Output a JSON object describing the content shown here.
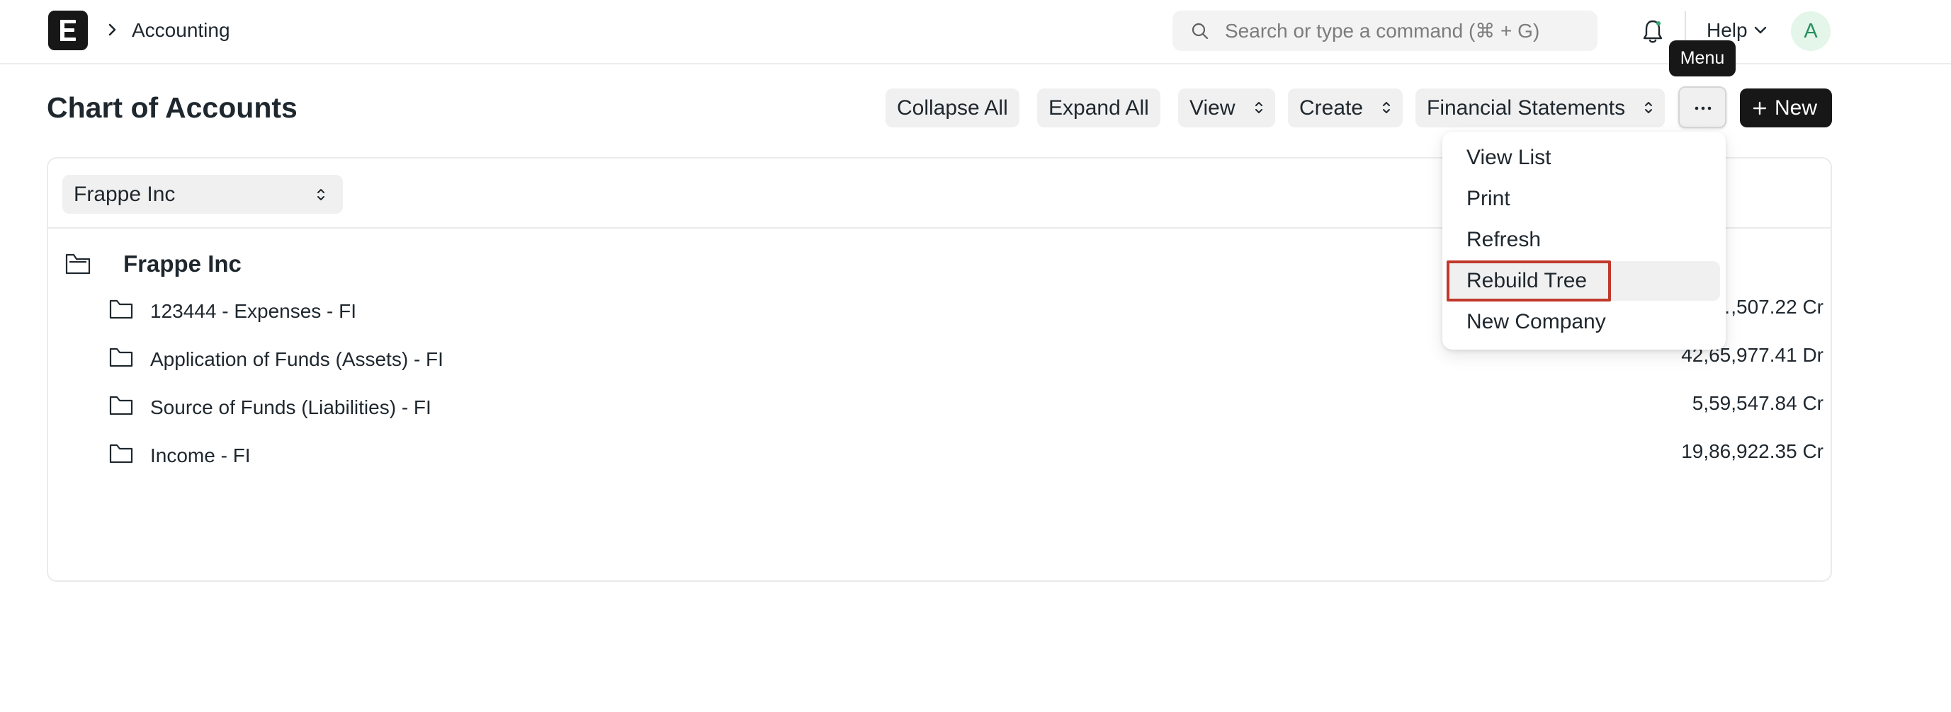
{
  "navbar": {
    "breadcrumb": "Accounting",
    "search_placeholder": "Search or type a command (⌘ + G)",
    "help_label": "Help",
    "avatar_initial": "A"
  },
  "page": {
    "title": "Chart of Accounts",
    "buttons": {
      "collapse_all": "Collapse All",
      "expand_all": "Expand All",
      "view": "View",
      "create": "Create",
      "financial_statements": "Financial Statements",
      "new": "New"
    },
    "tooltip": "Menu"
  },
  "tree": {
    "company": "Frappe Inc",
    "root_label": "Frappe Inc",
    "rows": [
      {
        "label": "123444 - Expenses - FI",
        "balance": "…,507.22 Cr"
      },
      {
        "label": "Application of Funds (Assets) - FI",
        "balance": "42,65,977.41 Dr"
      },
      {
        "label": "Source of Funds (Liabilities) - FI",
        "balance": "5,59,547.84 Cr"
      },
      {
        "label": "Income - FI",
        "balance": "19,86,922.35 Cr"
      }
    ]
  },
  "menu": {
    "items": [
      {
        "label": "View List"
      },
      {
        "label": "Print"
      },
      {
        "label": "Refresh"
      },
      {
        "label": "Rebuild Tree",
        "highlighted": true
      },
      {
        "label": "New Company"
      }
    ]
  },
  "colors": {
    "highlight_outline": "#c0392b",
    "primary_button": "#171717",
    "avatar_bg": "#e4f5e9",
    "avatar_text": "#278f5e"
  },
  "icons": {
    "logo": "app-logo-icon",
    "breadcrumb_separator": "chevron-right-icon",
    "search": "search-icon",
    "notifications": "bell-icon",
    "help_dropdown": "chevron-down-icon",
    "sort": "sort-icon",
    "more": "more-horizontal-icon",
    "new": "plus-icon",
    "root": "folder-open-icon",
    "row": "folder-icon"
  }
}
